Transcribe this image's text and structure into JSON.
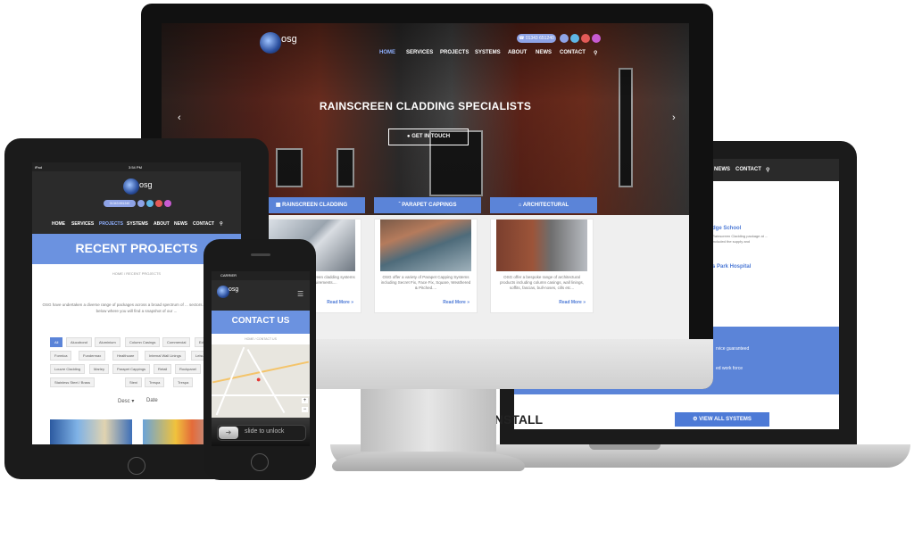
{
  "brand": {
    "logo_text": "osg",
    "phone": "01343 651240"
  },
  "desktop": {
    "nav": [
      "HOME",
      "SERVICES",
      "PROJECTS",
      "SYSTEMS",
      "ABOUT",
      "NEWS",
      "CONTACT"
    ],
    "hero_title": "RAINSCREEN CLADDING SPECIALISTS",
    "cta_label": "GET IN TOUCH",
    "tabs": [
      "RAINSCREEN CLADDING",
      "PARAPET CAPPINGS",
      "ARCHITECTURAL"
    ],
    "cards": [
      {
        "desc": "OSG offer a range of Rainscreen cladding systems to fit all design requirements....",
        "more": "Read More »"
      },
      {
        "desc": "OSG offer a variety of Parapet Capping Systems including Secret Fix, Face Fix, Square, Weathered & Pitched....",
        "more": "Read More »"
      },
      {
        "desc": "OSG offer a bespoke range of architectural products including column casings, wall linings, soffits, fascias, bull-noses, cills etc...",
        "more": "Read More »"
      }
    ]
  },
  "laptop": {
    "nav": [
      "NEWS",
      "CONTACT"
    ],
    "project_1": "dge School",
    "project_1_text": "Rainscreen Cladding package at ... included the supply and",
    "project_2": "s Park Hospital",
    "blue_1": "rvice guaranteed",
    "blue_2": "ed work force",
    "install": "INSTALL",
    "systems_btn": "VIEW ALL SYSTEMS"
  },
  "tablet": {
    "status_left": "iPad",
    "status_time": "3:54 PM",
    "nav": [
      "HOME",
      "SERVICES",
      "PROJECTS",
      "SYSTEMS",
      "ABOUT",
      "NEWS",
      "CONTACT"
    ],
    "page_title": "RECENT PROJECTS",
    "crumb_home": "HOME",
    "crumb_current": "RECENT PROJECTS",
    "intro": "OSG have undertaken a diverse range of packages across a broad spectrum of ... sectors. Please browse below where you will find a snapshot of our ...",
    "filters": [
      "All",
      "Alucobond",
      "Aluminium",
      "Column Casings",
      "Commercial",
      "Education",
      "Formica",
      "Fundermax",
      "Healthcare",
      "Internal Wall Linings",
      "Leisure",
      "Louvre Cladding",
      "Marley",
      "Parapet Cappings",
      "Retail",
      "Rockpanel",
      "Stainless Steel / Brass",
      "Steni",
      "Trespa",
      "Trespa"
    ],
    "sort_desc": "Desc",
    "sort_date": "Date"
  },
  "phone": {
    "carrier": "CARRIER",
    "page_title": "CONTACT US",
    "crumb_home": "HOME",
    "crumb_current": "CONTACT US",
    "slide": "slide to unlock"
  },
  "colors": {
    "accent": "#5b84d8",
    "dark": "#2b2b2b"
  }
}
